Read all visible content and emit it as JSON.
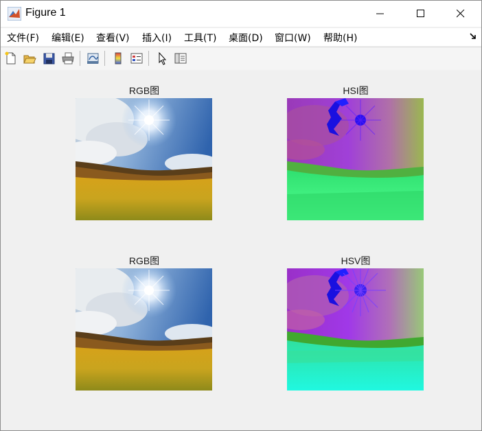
{
  "window": {
    "title": "Figure 1"
  },
  "menubar": {
    "items": [
      {
        "label": "文件(F)",
        "key": "F"
      },
      {
        "label": "编辑(E)",
        "key": "E"
      },
      {
        "label": "查看(V)",
        "key": "V"
      },
      {
        "label": "插入(I)",
        "key": "I"
      },
      {
        "label": "工具(T)",
        "key": "T"
      },
      {
        "label": "桌面(D)",
        "key": "D"
      },
      {
        "label": "窗口(W)",
        "key": "W"
      },
      {
        "label": "帮助(H)",
        "key": "H"
      }
    ]
  },
  "toolbar": {
    "icons": [
      "new-figure-icon",
      "open-file-icon",
      "save-icon",
      "print-icon",
      "link-plot-icon",
      "colorbar-icon",
      "legend-icon",
      "edit-plot-icon",
      "property-inspector-icon"
    ]
  },
  "subplots": [
    {
      "title": "RGB图",
      "image": "sunny meadow photo (RGB)"
    },
    {
      "title": "HSI图",
      "image": "sunny meadow converted to HSI"
    },
    {
      "title": "RGB图",
      "image": "sunny meadow photo (RGB)"
    },
    {
      "title": "HSV图",
      "image": "sunny meadow converted to HSV"
    }
  ],
  "colors": {
    "canvas": "#f0f0f0",
    "titlebar": "#ffffff"
  }
}
